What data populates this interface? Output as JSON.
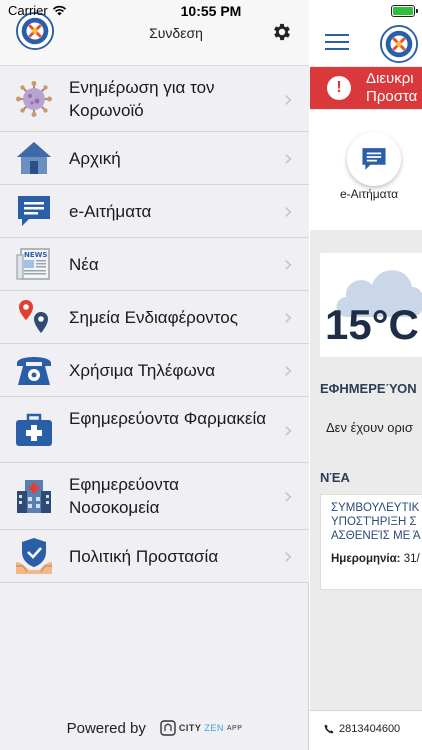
{
  "status_bar": {
    "carrier": "Carrier",
    "time": "10:55 PM",
    "battery_level": 1.0
  },
  "drawer": {
    "title": "Συνδεση",
    "settings_icon": "gear-icon",
    "items": [
      {
        "label": "Ενημέρωση για τον Κορωνοϊό",
        "icon": "coronavirus-icon"
      },
      {
        "label": "Αρχική",
        "icon": "home-icon"
      },
      {
        "label": "e-Αιτήματα",
        "icon": "chat-message-icon"
      },
      {
        "label": "Νέα",
        "icon": "newspaper-icon"
      },
      {
        "label": "Σημεία Ενδιαφέροντος",
        "icon": "map-pins-icon"
      },
      {
        "label": "Χρήσιμα Τηλέφωνα",
        "icon": "telephone-icon"
      },
      {
        "label": "Εφημερεύοντα Φαρμακεία",
        "icon": "medical-kit-icon"
      },
      {
        "label": "Εφημερεύοντα Νοσοκομεία",
        "icon": "hospital-icon"
      },
      {
        "label": "Πολιτική Προστασία",
        "icon": "civil-protection-icon"
      }
    ],
    "powered_by": "Powered by",
    "powered_logo": {
      "part1": "CITY",
      "part2": "ZEN",
      "part3": "APP"
    }
  },
  "main": {
    "alert_line1": "Διευκρι",
    "alert_line2": "Προστα",
    "quick_action_label": "e-Αιτήματα",
    "weather_temp": "15°C",
    "duty_section_title": "ΕΦΗΜΕΡΕΎΟΝ",
    "duty_text": "Δεν έχουν ορισ",
    "news_section_title": "ΝΈΑ",
    "news_title_lines": [
      "ΣΥΜΒΟΥΛΕΥΤΙΚ",
      "ΥΠΟΣΤΉΡΙΞΗ Σ",
      "ΑΣΘΕΝΕΊΣ ΜΕ Ά"
    ],
    "news_date_label": "Ημερομηνία:",
    "news_date_value": "31/",
    "phone": "2813404600"
  },
  "colors": {
    "brand_blue": "#2a5fa8",
    "alert_red": "#d9393a",
    "drawer_bg": "#efeff4",
    "section_title": "#2c3e55"
  }
}
